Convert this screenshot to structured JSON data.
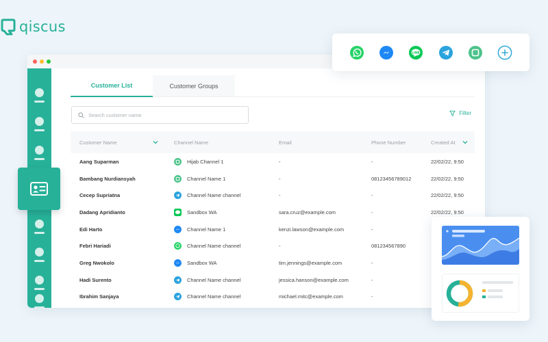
{
  "brand": {
    "name": "qiscus",
    "color": "#27b199"
  },
  "window_dots": [
    "#ff5f57",
    "#febc2e",
    "#28c840"
  ],
  "sidebar": {
    "items_above": 4,
    "items_below": 5,
    "active_icon": "contact-card-icon"
  },
  "tabs": [
    {
      "label": "Customer List",
      "active": true
    },
    {
      "label": "Customer Groups",
      "active": false
    }
  ],
  "search": {
    "placeholder": "Search customer name"
  },
  "filter": {
    "label": "Filter",
    "icon": "filter-icon"
  },
  "table": {
    "columns": [
      "Customer Name",
      "Channel Name",
      "Email",
      "Phone Number",
      "Created At"
    ],
    "rows": [
      {
        "name": "Aang Suparman",
        "channel_type": "qiscus",
        "channel": "Hijab Channel 1",
        "email": "-",
        "phone": "-",
        "created": "22/02/22, 9:50"
      },
      {
        "name": "Bambang Nurdiansyah",
        "channel_type": "qiscus",
        "channel": "Channel Name 1",
        "email": "-",
        "phone": "08123456789012",
        "created": "22/02/22, 9:50"
      },
      {
        "name": "Cecep Supriatna",
        "channel_type": "telegram",
        "channel": "Channel Name channel",
        "email": "-",
        "phone": "-",
        "created": "22/02/22, 9:50"
      },
      {
        "name": "Dadang Apridianto",
        "channel_type": "line",
        "channel": "Sandbox WA",
        "email": "sara.cruz@example.com",
        "phone": "-",
        "created": "22/02/22, 9:50"
      },
      {
        "name": "Edi Harto",
        "channel_type": "messenger",
        "channel": "Channel Name 1",
        "email": "kenzi.lawson@example.com",
        "phone": "-",
        "created": ""
      },
      {
        "name": "Febri Hariadi",
        "channel_type": "whatsapp",
        "channel": "Channel Name channel",
        "email": "-",
        "phone": "081234567890",
        "created": ""
      },
      {
        "name": "Greg Nwokolo",
        "channel_type": "messenger",
        "channel": "Sandbox WA",
        "email": "tim.jennings@example.com",
        "phone": "-",
        "created": ""
      },
      {
        "name": "Hadi Surento",
        "channel_type": "telegram",
        "channel": "Channel Name channel",
        "email": "jessica.hanson@example.com",
        "phone": "-",
        "created": ""
      },
      {
        "name": "Ibrahim Sanjaya",
        "channel_type": "telegram",
        "channel": "Channel Name channel",
        "email": "michael.mitc@example.com",
        "phone": "-",
        "created": ""
      }
    ]
  },
  "channel_icons": [
    "whatsapp-icon",
    "messenger-icon",
    "line-icon",
    "telegram-icon",
    "qiscus-icon",
    "add-channel-icon"
  ],
  "channel_colors": {
    "whatsapp": "#25d366",
    "messenger": "#1e88f5",
    "line": "#06c755",
    "telegram": "#2aa3de",
    "qiscus": "#4cc38a",
    "add": "#2fa7d8"
  },
  "analytics": {
    "area_color": "#4a8ff0",
    "donut_colors": [
      "#27b199",
      "#f5b330"
    ]
  }
}
